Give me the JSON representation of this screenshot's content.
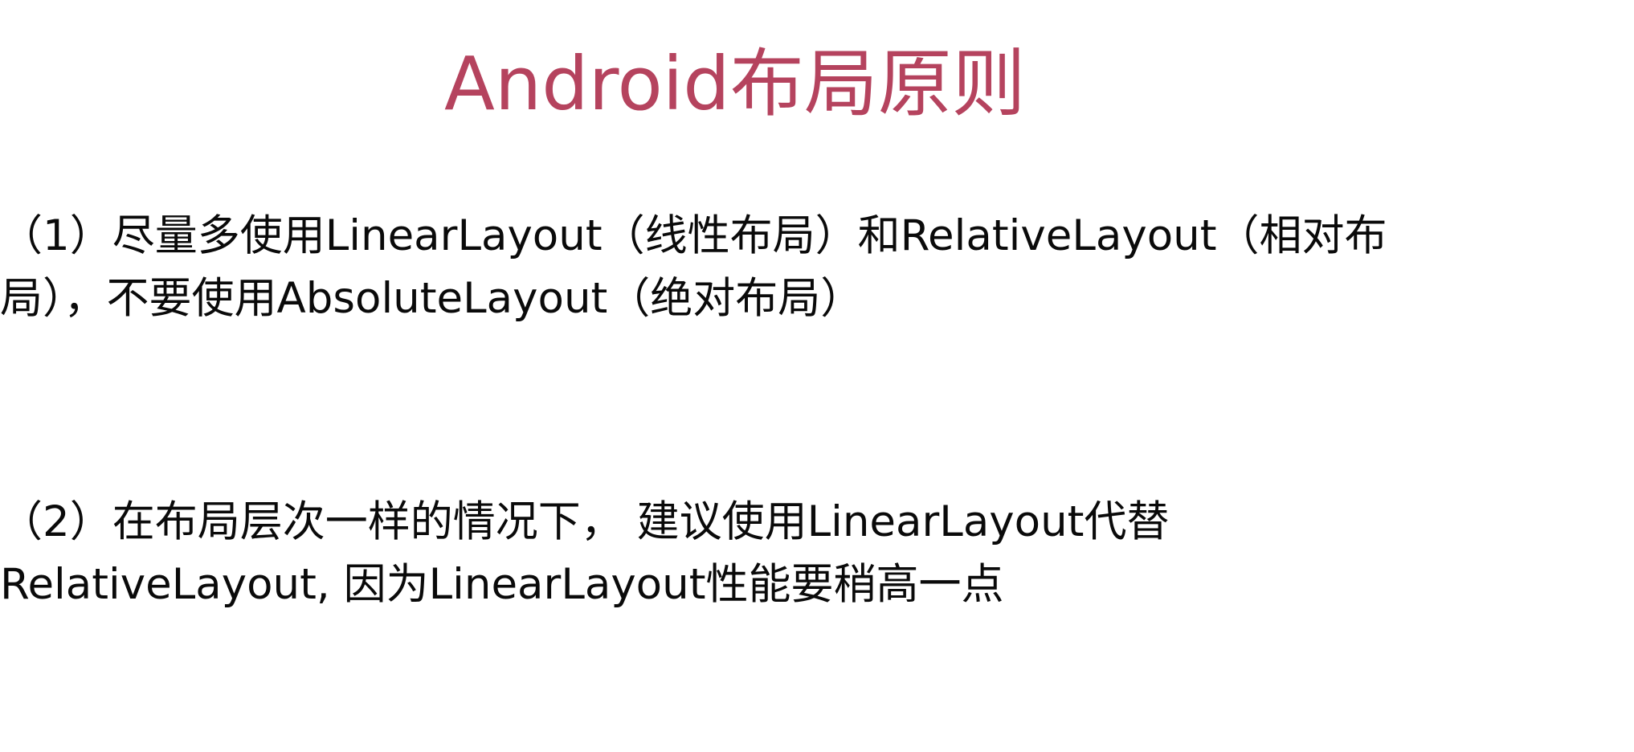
{
  "slide": {
    "title": "Android布局原则",
    "title_color": "#b5435e",
    "points": [
      {
        "line1": "（1）尽量多使用LinearLayout（线性布局）和RelativeLayout（相对布",
        "line2": "局），不要使用AbsoluteLayout（绝对布局）"
      },
      {
        "line1": "（2）在布局层次一样的情况下， 建议使用LinearLayout代替",
        "line2": "RelativeLayout, 因为LinearLayout性能要稍高一点"
      }
    ]
  }
}
